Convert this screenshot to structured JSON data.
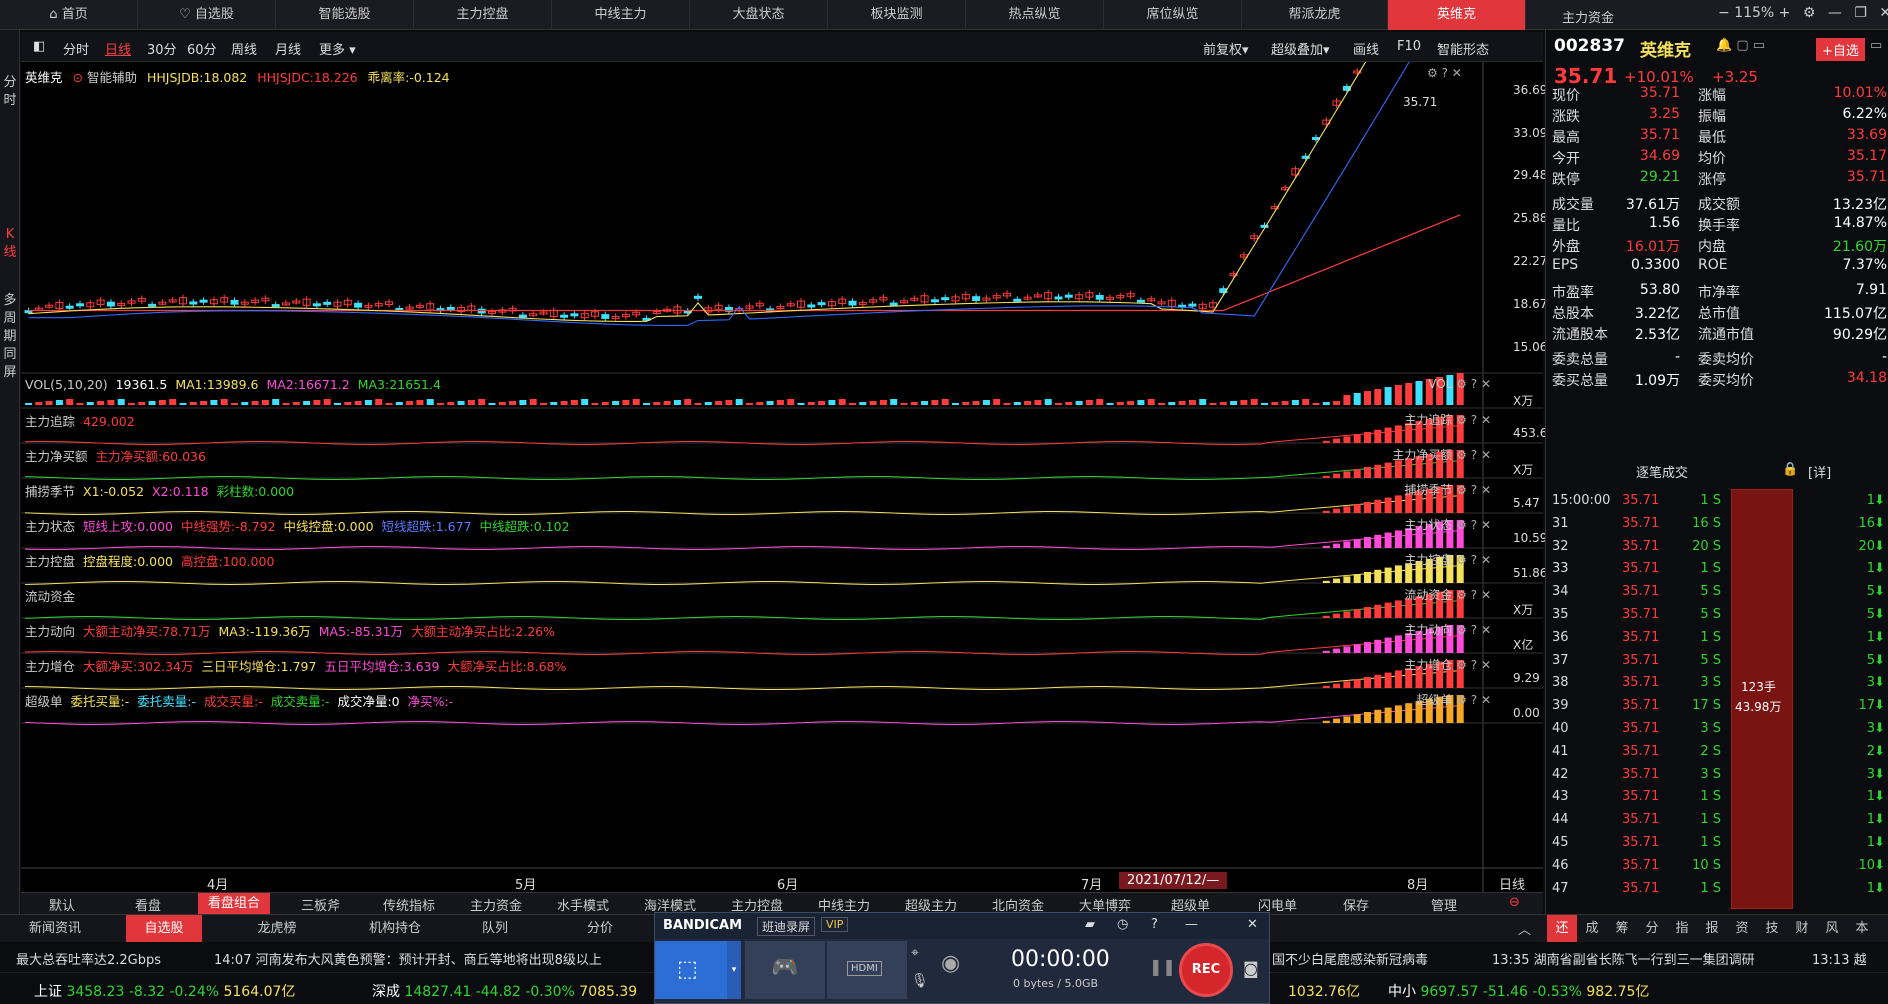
{
  "topnav": {
    "tabs": [
      "首页",
      "自选股",
      "智能选股",
      "主力控盘",
      "中线主力",
      "大盘状态",
      "板块监测",
      "热点纵览",
      "席位纵览",
      "帮派龙虎",
      "英维克"
    ],
    "right_title": "主力资金",
    "zoom": "115%"
  },
  "leftbar": {
    "items": [
      "分时",
      "K线",
      "多周期同屏"
    ]
  },
  "toolbar": {
    "periods": [
      "分时",
      "日线",
      "30分",
      "60分",
      "周线",
      "月线",
      "更多 ▾"
    ],
    "right": [
      "前复权▾",
      "超级叠加▾",
      "画线",
      "F10",
      "智能形态"
    ]
  },
  "main": {
    "name": "英维克",
    "assist": "智能辅助",
    "hhjsjdb": "HHJSJDB:18.082",
    "hhjsjdc": "HHJSJDC:18.226",
    "deviation": "乖离率:-0.124",
    "price_tag": "35.71",
    "yticks": [
      "36.69",
      "33.09",
      "29.48",
      "25.88",
      "22.27",
      "18.67",
      "15.06"
    ]
  },
  "panels": [
    {
      "name": "VOL(5,10,20)",
      "items": [
        {
          "t": "19361.5",
          "c": "white"
        },
        {
          "t": "MA1:13989.6",
          "c": "yellow"
        },
        {
          "t": "MA2:16671.2",
          "c": "magenta"
        },
        {
          "t": "MA3:21651.4",
          "c": "green"
        }
      ],
      "right": "VOL",
      "yval": "X万"
    },
    {
      "name": "主力追踪",
      "items": [
        {
          "t": "429.002",
          "c": "red"
        }
      ],
      "right": "主力追踪",
      "yval": "453.66"
    },
    {
      "name": "主力净买额",
      "items": [
        {
          "t": "主力净买额:60.036",
          "c": "red"
        }
      ],
      "right": "主力净买额",
      "yval": "X万"
    },
    {
      "name": "捕捞季节",
      "items": [
        {
          "t": "X1:-0.052",
          "c": "yellow"
        },
        {
          "t": "X2:0.118",
          "c": "magenta"
        },
        {
          "t": "彩柱数:0.000",
          "c": "green"
        }
      ],
      "right": "捕捞季节",
      "yval": "5.47"
    },
    {
      "name": "主力状态",
      "items": [
        {
          "t": "短线上攻:0.000",
          "c": "magenta"
        },
        {
          "t": "中线强势:-8.792",
          "c": "red"
        },
        {
          "t": "中线控盘:0.000",
          "c": "yellow"
        },
        {
          "t": "短线超跌:1.677",
          "c": "blue"
        },
        {
          "t": "中线超跌:0.102",
          "c": "green"
        }
      ],
      "right": "主力状态",
      "yval": "10.59"
    },
    {
      "name": "主力控盘",
      "items": [
        {
          "t": "控盘程度:0.000",
          "c": "yellow"
        },
        {
          "t": "高控盘:100.000",
          "c": "red"
        }
      ],
      "right": "主力控盘",
      "yval": "51.86"
    },
    {
      "name": "流动资金",
      "items": [],
      "right": "流动资金",
      "yval": "X万"
    },
    {
      "name": "主力动向",
      "items": [
        {
          "t": "大额主动净买:78.71万",
          "c": "red"
        },
        {
          "t": "MA3:-119.36万",
          "c": "yellow"
        },
        {
          "t": "MA5:-85.31万",
          "c": "magenta"
        },
        {
          "t": "大额主动净买占比:2.26%",
          "c": "red"
        }
      ],
      "right": "主力动向",
      "yval": "X亿"
    },
    {
      "name": "主力增仓",
      "items": [
        {
          "t": "大额净买:302.34万",
          "c": "red"
        },
        {
          "t": "三日平均增仓:1.797",
          "c": "yellow"
        },
        {
          "t": "五日平均增仓:3.639",
          "c": "magenta"
        },
        {
          "t": "大额净买占比:8.68%",
          "c": "red"
        }
      ],
      "right": "主力增仓",
      "yval": "9.29"
    },
    {
      "name": "超级单",
      "items": [
        {
          "t": "委托买量:-",
          "c": "yellow"
        },
        {
          "t": "委托卖量:-",
          "c": "cyan"
        },
        {
          "t": "成交买量:-",
          "c": "red"
        },
        {
          "t": "成交卖量:-",
          "c": "green"
        },
        {
          "t": "成交净量:0",
          "c": "white"
        },
        {
          "t": "净买%:-",
          "c": "magenta"
        }
      ],
      "right": "超级单",
      "yval": "0.00"
    }
  ],
  "xaxis": {
    "months": [
      "4月",
      "5月",
      "6月",
      "7月",
      "8月"
    ],
    "cursor_date": "2021/07/12/—",
    "right": "日线"
  },
  "bottomtabs": {
    "items": [
      "默认",
      "看盘",
      "看盘组合",
      "三板斧",
      "传统指标",
      "主力资金",
      "水手模式",
      "海洋模式",
      "主力控盘",
      "中线主力",
      "超级主力",
      "北向资金",
      "大单博弈",
      "超级单",
      "闪电单",
      "保存",
      "管理"
    ]
  },
  "quote": {
    "code": "002837",
    "name": "英维克",
    "price": "35.71",
    "change_pct": "+10.01%",
    "change": "+3.25",
    "add_label": "+自选",
    "rows": [
      [
        {
          "l": "现价",
          "v": "35.71",
          "c": "red"
        },
        {
          "l": "涨幅",
          "v": "10.01%",
          "c": "red"
        }
      ],
      [
        {
          "l": "涨跌",
          "v": "3.25",
          "c": "red"
        },
        {
          "l": "振幅",
          "v": "6.22%",
          "c": "white"
        }
      ],
      [
        {
          "l": "最高",
          "v": "35.71",
          "c": "red"
        },
        {
          "l": "最低",
          "v": "33.69",
          "c": "red"
        }
      ],
      [
        {
          "l": "今开",
          "v": "34.69",
          "c": "red"
        },
        {
          "l": "均价",
          "v": "35.17",
          "c": "red"
        }
      ],
      [
        {
          "l": "跌停",
          "v": "29.21",
          "c": "green"
        },
        {
          "l": "涨停",
          "v": "35.71",
          "c": "red"
        }
      ],
      [
        {
          "l": "成交量",
          "v": "37.61万",
          "c": "white"
        },
        {
          "l": "成交额",
          "v": "13.23亿",
          "c": "white"
        }
      ],
      [
        {
          "l": "量比",
          "v": "1.56",
          "c": "white"
        },
        {
          "l": "换手率",
          "v": "14.87%",
          "c": "white"
        }
      ],
      [
        {
          "l": "外盘",
          "v": "16.01万",
          "c": "red"
        },
        {
          "l": "内盘",
          "v": "21.60万",
          "c": "green"
        }
      ],
      [
        {
          "l": "EPS",
          "v": "0.3300",
          "c": "white"
        },
        {
          "l": "ROE",
          "v": "7.37%",
          "c": "white"
        }
      ],
      [
        {
          "l": "市盈率",
          "v": "53.80",
          "c": "white"
        },
        {
          "l": "市净率",
          "v": "7.91",
          "c": "white"
        }
      ],
      [
        {
          "l": "总股本",
          "v": "3.22亿",
          "c": "white"
        },
        {
          "l": "总市值",
          "v": "115.07亿",
          "c": "white"
        }
      ],
      [
        {
          "l": "流通股本",
          "v": "2.53亿",
          "c": "white"
        },
        {
          "l": "流通市值",
          "v": "90.29亿",
          "c": "white"
        }
      ],
      [
        {
          "l": "委卖总量",
          "v": "-",
          "c": "white"
        },
        {
          "l": "委卖均价",
          "v": "-",
          "c": "white"
        }
      ],
      [
        {
          "l": "委买总量",
          "v": "1.09万",
          "c": "white"
        },
        {
          "l": "委买均价",
          "v": "34.18",
          "c": "red"
        }
      ]
    ],
    "trades_title": "逐笔成交",
    "trades_detail": "[详]",
    "trades": [
      [
        "15:00:00",
        "35.71",
        "1 S",
        "1"
      ],
      [
        "31",
        "35.71",
        "16 S",
        "16"
      ],
      [
        "32",
        "35.71",
        "20 S",
        "20"
      ],
      [
        "33",
        "35.71",
        "1 S",
        "1"
      ],
      [
        "34",
        "35.71",
        "5 S",
        "5"
      ],
      [
        "35",
        "35.71",
        "5 S",
        "5"
      ],
      [
        "36",
        "35.71",
        "1 S",
        "1"
      ],
      [
        "37",
        "35.71",
        "5 S",
        "5"
      ],
      [
        "38",
        "35.71",
        "3 S",
        "3"
      ],
      [
        "39",
        "35.71",
        "17 S",
        "17"
      ],
      [
        "40",
        "35.71",
        "3 S",
        "3"
      ],
      [
        "41",
        "35.71",
        "2 S",
        "2"
      ],
      [
        "42",
        "35.71",
        "3 S",
        "3"
      ],
      [
        "43",
        "35.71",
        "1 S",
        "1"
      ],
      [
        "44",
        "35.71",
        "1 S",
        "1"
      ],
      [
        "45",
        "35.71",
        "1 S",
        "1"
      ],
      [
        "46",
        "35.71",
        "10 S",
        "10"
      ],
      [
        "47",
        "35.71",
        "1 S",
        "1"
      ]
    ],
    "bigbar_lot": "123手",
    "bigbar_amt": "43.98万",
    "tabs": [
      "还",
      "成",
      "筹",
      "分",
      "指",
      "报",
      "资",
      "技",
      "财",
      "风",
      "本"
    ]
  },
  "newsbar": {
    "tabs": [
      "新闻资讯",
      "自选股",
      "龙虎榜",
      "机构持仓",
      "队列",
      "分价"
    ]
  },
  "ticker": {
    "left": "最大总吞吐率达2.2Gbps",
    "news1": "14:07 河南发布大风黄色预警：预计开封、商丘等地将出现8级以上",
    "news2": "国不少白尾鹿感染新冠病毒",
    "news3": "13:35 湖南省副省长陈飞一行到三一集团调研",
    "news4": "13:13 越"
  },
  "indices": [
    {
      "name": "上证",
      "val": "3458.23",
      "chg": "-8.32",
      "pct": "-0.24%",
      "amt": "5164.07亿"
    },
    {
      "name": "深成",
      "val": "14827.41",
      "chg": "-44.82",
      "pct": "-0.30%",
      "amt": "7085.39"
    },
    {
      "name": "",
      "val": "",
      "chg": "",
      "pct": "",
      "amt": "1032.76亿"
    },
    {
      "name": "中小",
      "val": "9697.57",
      "chg": "-51.46",
      "pct": "-0.53%",
      "amt": "982.75亿"
    }
  ],
  "bandicam": {
    "brand": "BANDICAM",
    "mode": "班迪录屏",
    "vip": "VIP",
    "time": "00:00:00",
    "size": "0 bytes / 5.0GB",
    "rec": "REC",
    "hdmi": "HDMI"
  },
  "colors": {
    "up": "#ff3b3b",
    "down": "#2fd42f",
    "accent": "#e0363c",
    "bg": "#000000"
  }
}
